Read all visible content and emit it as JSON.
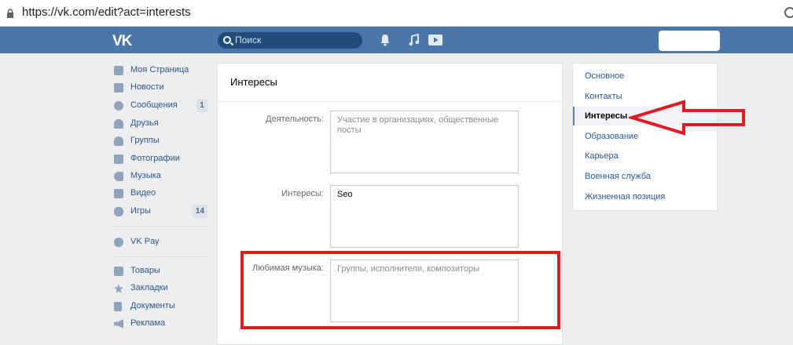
{
  "browser": {
    "url": "https://vk.com/edit?act=interests"
  },
  "header": {
    "logo": "VK",
    "search_placeholder": "Поиск"
  },
  "left_menu": {
    "items": [
      {
        "label": "Моя Страница",
        "icon": "home-icon"
      },
      {
        "label": "Новости",
        "icon": "news-icon"
      },
      {
        "label": "Сообщения",
        "icon": "messages-icon",
        "badge": "1"
      },
      {
        "label": "Друзья",
        "icon": "friends-icon"
      },
      {
        "label": "Группы",
        "icon": "groups-icon"
      },
      {
        "label": "Фотографии",
        "icon": "photos-icon"
      },
      {
        "label": "Музыка",
        "icon": "music-icon"
      },
      {
        "label": "Видео",
        "icon": "video-icon"
      },
      {
        "label": "Игры",
        "icon": "games-icon",
        "badge": "14"
      },
      {
        "label": "VK Pay",
        "icon": "vkpay-icon"
      },
      {
        "label": "Товары",
        "icon": "goods-icon"
      },
      {
        "label": "Закладки",
        "icon": "bookmarks-icon"
      },
      {
        "label": "Документы",
        "icon": "documents-icon"
      },
      {
        "label": "Реклама",
        "icon": "ads-icon"
      }
    ]
  },
  "main": {
    "title": "Интересы",
    "fields": [
      {
        "label": "Деятельность:",
        "value": "",
        "placeholder": "Участие в организациях, общественные посты"
      },
      {
        "label": "Интересы:",
        "value": "Seo",
        "placeholder": ""
      },
      {
        "label": "Любимая музыка:",
        "value": "",
        "placeholder": "Группы, исполнители, композиторы"
      }
    ]
  },
  "right_menu": {
    "items": [
      {
        "label": "Основное",
        "active": false
      },
      {
        "label": "Контакты",
        "active": false
      },
      {
        "label": "Интересы",
        "active": true
      },
      {
        "label": "Образование",
        "active": false
      },
      {
        "label": "Карьера",
        "active": false
      },
      {
        "label": "Военная служба",
        "active": false
      },
      {
        "label": "Жизненная позиция",
        "active": false
      }
    ]
  },
  "colors": {
    "header": "#4a76a8",
    "link": "#2a5885",
    "annotation": "#e01b24"
  }
}
